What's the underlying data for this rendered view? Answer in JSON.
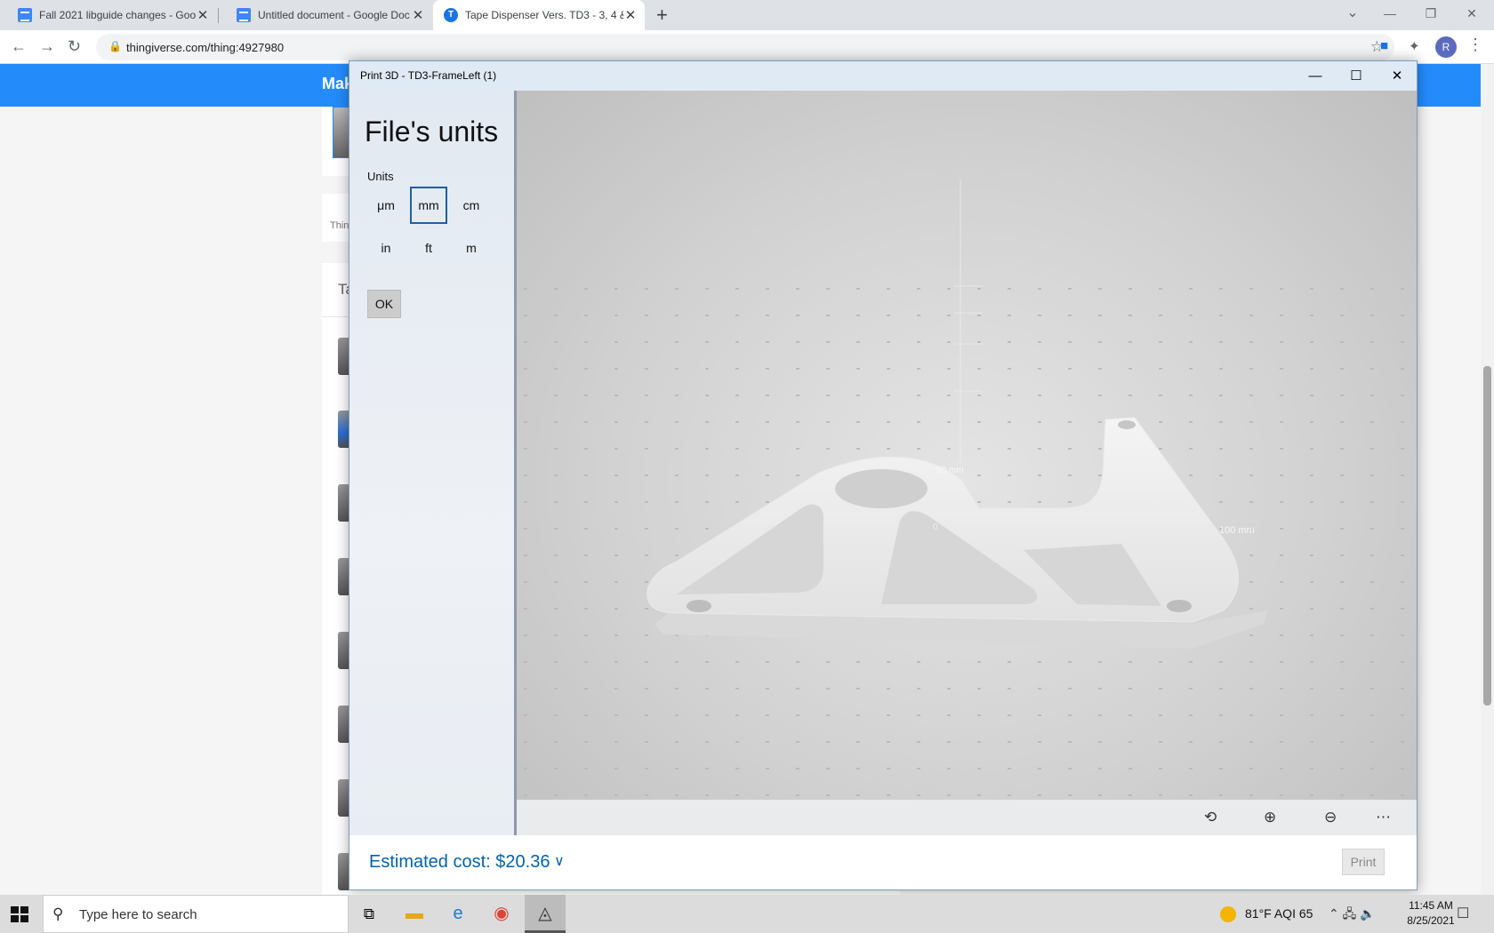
{
  "browser": {
    "tabs": [
      {
        "title": "Fall 2021 libguide changes - Goo",
        "icon": "docs-icon"
      },
      {
        "title": "Untitled document - Google Doc",
        "icon": "docs-icon"
      },
      {
        "title": "Tape Dispenser Vers. TD3 - 3, 4 &",
        "icon": "thingiverse-icon",
        "active": true
      }
    ],
    "url": "thingiverse.com/thing:4927980",
    "profile_initial": "R"
  },
  "site": {
    "logo": "Mak",
    "card_snippet": "Thin",
    "tab_snippet": "Ta"
  },
  "app": {
    "title": "Print 3D - TD3-FrameLeft (1)",
    "panel_heading": "File's units",
    "units_label": "Units",
    "units": [
      "μm",
      "mm",
      "cm",
      "in",
      "ft",
      "m"
    ],
    "selected_unit": "mm",
    "ok_label": "OK",
    "estimated_cost": "Estimated cost: $20.36",
    "print_label": "Print",
    "scale_labels": {
      "y": "50 mm",
      "x": "100 mm",
      "origin": "0"
    }
  },
  "taskbar": {
    "search_placeholder": "Type here to search",
    "weather": "81°F  AQI 65",
    "time": "11:45 AM",
    "date": "8/25/2021"
  }
}
